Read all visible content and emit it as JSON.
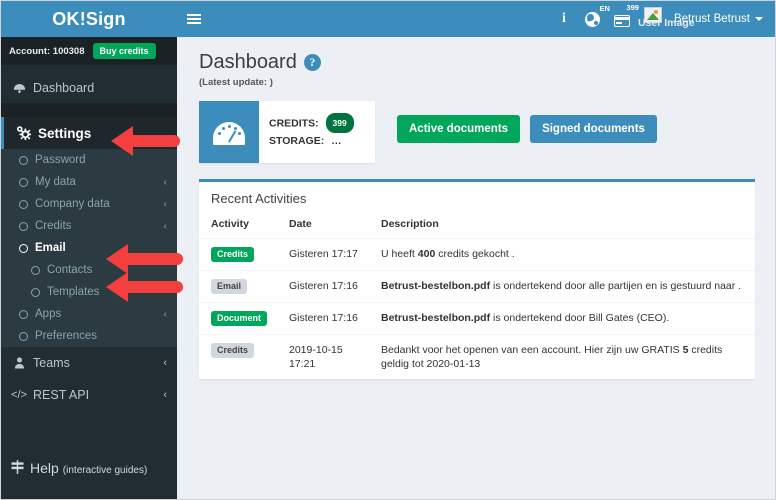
{
  "brand": {
    "title": "OK!Sign"
  },
  "sidebar": {
    "account": {
      "label": "Account: 100308",
      "buy_button": "Buy credits"
    },
    "dashboard": {
      "label": "Dashboard",
      "icon": "dashboard-icon"
    },
    "settings": {
      "label": "Settings",
      "icon": "gear-icon"
    },
    "settings_items": [
      {
        "label": "Password",
        "chevron": "",
        "active": false
      },
      {
        "label": "My data",
        "chevron": "‹",
        "active": false
      },
      {
        "label": "Company data",
        "chevron": "‹",
        "active": false
      },
      {
        "label": "Credits",
        "chevron": "‹",
        "active": false
      },
      {
        "label": "Email",
        "chevron": "",
        "active": true
      },
      {
        "label": "Contacts",
        "chevron": "",
        "active": false,
        "level": 2
      },
      {
        "label": "Templates",
        "chevron": "",
        "active": false,
        "level": 2
      },
      {
        "label": "Apps",
        "chevron": "‹",
        "active": false
      },
      {
        "label": "Preferences",
        "chevron": "",
        "active": false
      }
    ],
    "teams": {
      "label": "Teams",
      "chevron": "‹",
      "icon": "user-icon"
    },
    "rest_api": {
      "label": "REST API",
      "chevron": "‹",
      "icon": "code-icon"
    },
    "help": {
      "label": "Help",
      "sub": "(interactive guides)",
      "icon": "signpost-icon"
    }
  },
  "topbar": {
    "menu_toggle": "hamburger-icon",
    "info_icon": "i",
    "language": "EN",
    "credits_count": "399",
    "user_image_alt": "User Image",
    "user_name": "Betrust Betrust"
  },
  "main": {
    "page_title": "Dashboard",
    "help_badge": "?",
    "latest_update": "(Latest update: )",
    "credits_widget": {
      "credits_label": "CREDITS:",
      "credits_value": "399",
      "storage_label": "STORAGE:",
      "storage_value": "…"
    },
    "buttons": {
      "active_documents": "Active documents",
      "signed_documents": "Signed documents"
    },
    "panel": {
      "title": "Recent Activities",
      "columns": [
        "Activity",
        "Date",
        "Description"
      ],
      "rows": [
        {
          "activity": "Credits",
          "badge_color": "green",
          "date": "Gisteren 17:17",
          "desc_pre": "U heeft ",
          "desc_bold": "400",
          "desc_post": " credits gekocht ."
        },
        {
          "activity": "Email",
          "badge_color": "gray",
          "date": "Gisteren 17:16",
          "desc_pre": "",
          "desc_bold": "Betrust-bestelbon.pdf",
          "desc_post": " is ondertekend door alle partijen en is gestuurd naar ."
        },
        {
          "activity": "Document",
          "badge_color": "green",
          "date": "Gisteren 17:16",
          "desc_pre": "",
          "desc_bold": "Betrust-bestelbon.pdf",
          "desc_post": " is ondertekend door Bill Gates (CEO)."
        },
        {
          "activity": "Credits",
          "badge_color": "gray",
          "date": "2019-10-15 17:21",
          "desc_pre": "Bedankt voor het openen van een account. Hier zijn uw GRATIS ",
          "desc_bold": "5",
          "desc_post": " credits geldig tot 2020-01-13"
        }
      ]
    }
  },
  "annotations": {
    "arrows": [
      {
        "name": "arrow-settings"
      },
      {
        "name": "arrow-email"
      },
      {
        "name": "arrow-contacts"
      }
    ]
  },
  "colors": {
    "brand_blue": "#3c8dbc",
    "sidebar_dark": "#222d32",
    "green": "#00a65a",
    "arrow_red": "#f43f3f"
  }
}
